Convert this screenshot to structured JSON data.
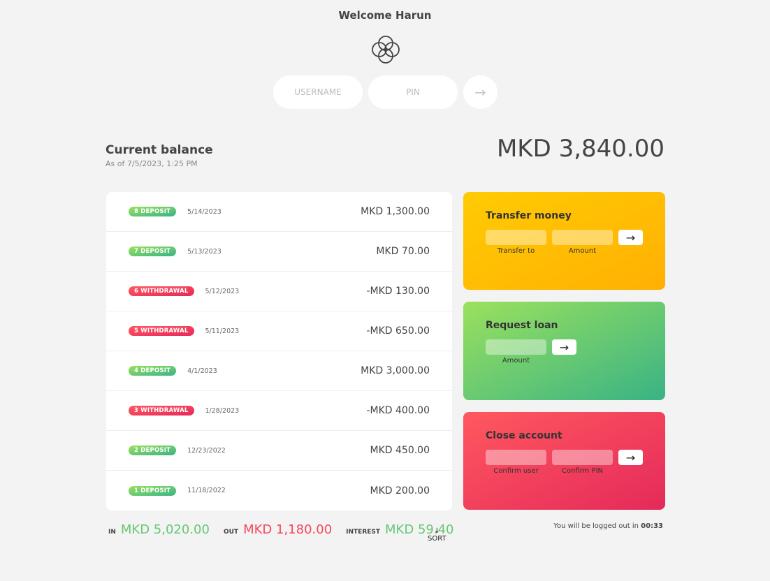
{
  "header": {
    "welcome": "Welcome Harun",
    "username_placeholder": "USERNAME",
    "pin_placeholder": "PIN",
    "login_button": "→"
  },
  "balance": {
    "title": "Current balance",
    "date_prefix": "As of",
    "date": "7/5/2023, 1:25 PM",
    "amount": "MKD 3,840.00"
  },
  "movements": [
    {
      "type_label": "8 DEPOSIT",
      "kind": "deposit",
      "date": "5/14/2023",
      "value": "MKD 1,300.00"
    },
    {
      "type_label": "7 DEPOSIT",
      "kind": "deposit",
      "date": "5/13/2023",
      "value": "MKD 70.00"
    },
    {
      "type_label": "6 WITHDRAWAL",
      "kind": "withdrawal",
      "date": "5/12/2023",
      "value": "-MKD 130.00"
    },
    {
      "type_label": "5 WITHDRAWAL",
      "kind": "withdrawal",
      "date": "5/11/2023",
      "value": "-MKD 650.00"
    },
    {
      "type_label": "4 DEPOSIT",
      "kind": "deposit",
      "date": "4/1/2023",
      "value": "MKD 3,000.00"
    },
    {
      "type_label": "3 WITHDRAWAL",
      "kind": "withdrawal",
      "date": "1/28/2023",
      "value": "-MKD 400.00"
    },
    {
      "type_label": "2 DEPOSIT",
      "kind": "deposit",
      "date": "12/23/2022",
      "value": "MKD 450.00"
    },
    {
      "type_label": "1 DEPOSIT",
      "kind": "deposit",
      "date": "11/18/2022",
      "value": "MKD 200.00"
    }
  ],
  "summary": {
    "in_label": "IN",
    "in_value": "MKD 5,020.00",
    "out_label": "OUT",
    "out_value": "MKD 1,180.00",
    "interest_label": "INTEREST",
    "interest_value": "MKD 59.40",
    "sort_arrow": "↓",
    "sort_label": "SORT"
  },
  "operations": {
    "transfer": {
      "title": "Transfer money",
      "to_label": "Transfer to",
      "amount_label": "Amount",
      "button": "→"
    },
    "loan": {
      "title": "Request loan",
      "amount_label": "Amount",
      "button": "→"
    },
    "close": {
      "title": "Close account",
      "user_label": "Confirm user",
      "pin_label": "Confirm PIN",
      "button": "→"
    }
  },
  "logout": {
    "text": "You will be logged out in",
    "timer": "00:33"
  },
  "colors": {
    "deposit_start": "#9be15d",
    "deposit_end": "#39b385",
    "withdrawal_start": "#ff585f",
    "withdrawal_end": "#e52a5a",
    "transfer_start": "#ffcb03",
    "transfer_end": "#ffb003",
    "in_value": "#66c873",
    "out_value": "#f5465d"
  }
}
